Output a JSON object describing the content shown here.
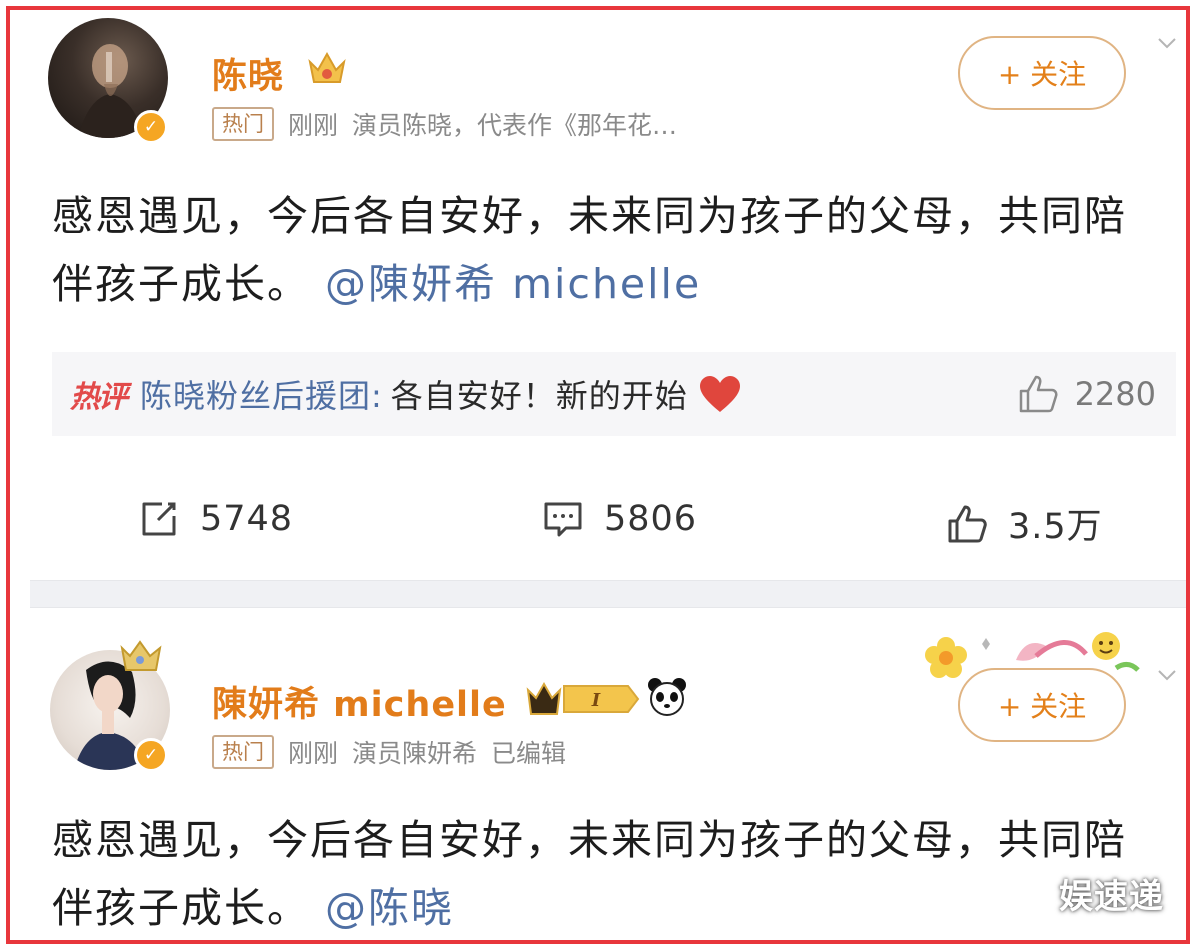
{
  "post1": {
    "author": "陈晓",
    "hot_tag": "热门",
    "time": "刚刚",
    "source": "演员陈晓，代表作《那年花…",
    "follow_label": "+ 关注",
    "content": "感恩遇见，今后各自安好，未来同为孩子的父母，共同陪伴孩子成长。",
    "mention": "@陳妍希 michelle",
    "hot_comment": {
      "label": "热评",
      "user": "陈晓粉丝后援团:",
      "text": "各自安好！新的开始",
      "likes": "2280"
    },
    "actions": {
      "reposts": "5748",
      "comments": "5806",
      "likes": "3.5万"
    }
  },
  "post2": {
    "author": "陳妍希 michelle",
    "hot_tag": "热门",
    "time": "刚刚",
    "source": "演员陳妍希",
    "edited": "已编辑",
    "follow_label": "+ 关注",
    "content": "感恩遇见，今后各自安好，未来同为孩子的父母，共同陪伴孩子成长。",
    "mention": "@陈晓"
  },
  "watermark": "娱速递",
  "colors": {
    "frame": "#e8363c",
    "name": "#e27c1a",
    "mention": "#4f6fa3",
    "follow_border": "#e0b483"
  },
  "icons": [
    "verified-badge-icon",
    "crown-icon",
    "chevron-down-icon",
    "heart-icon",
    "thumb-up-icon",
    "repost-icon",
    "comment-icon",
    "panda-icon"
  ]
}
